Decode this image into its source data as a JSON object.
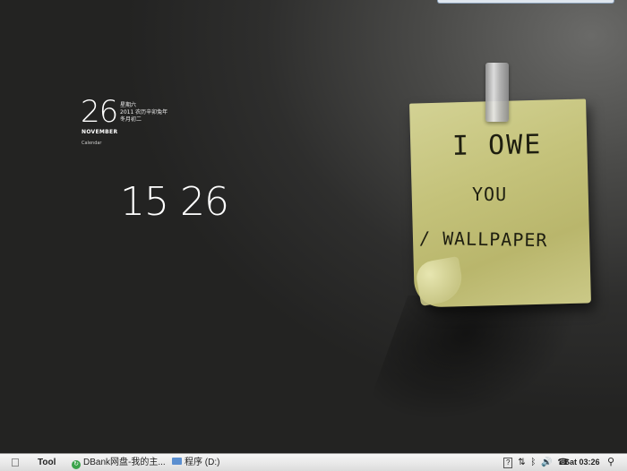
{
  "calendar": {
    "day": "26",
    "month": "NOVEMBER",
    "weekday": "星期六",
    "lunar_year": "2011 农历辛卯兔年",
    "lunar_date": "冬月初二",
    "caption": "Calendar"
  },
  "clock": {
    "time": "15 26"
  },
  "note": {
    "line1": "I OWE",
    "line2": "YOU",
    "line3": "/ WALLPAPER"
  },
  "taskbar": {
    "apple_icon": "apple-logo-icon",
    "tool_label": "Tool",
    "tasks": [
      {
        "label": "DBank网盘-我的主...",
        "icon": "dbank-icon"
      },
      {
        "label": "程序 (D:)",
        "icon": "folder-icon"
      }
    ],
    "tray": {
      "help": "?",
      "time": "Sat 03:26"
    }
  }
}
